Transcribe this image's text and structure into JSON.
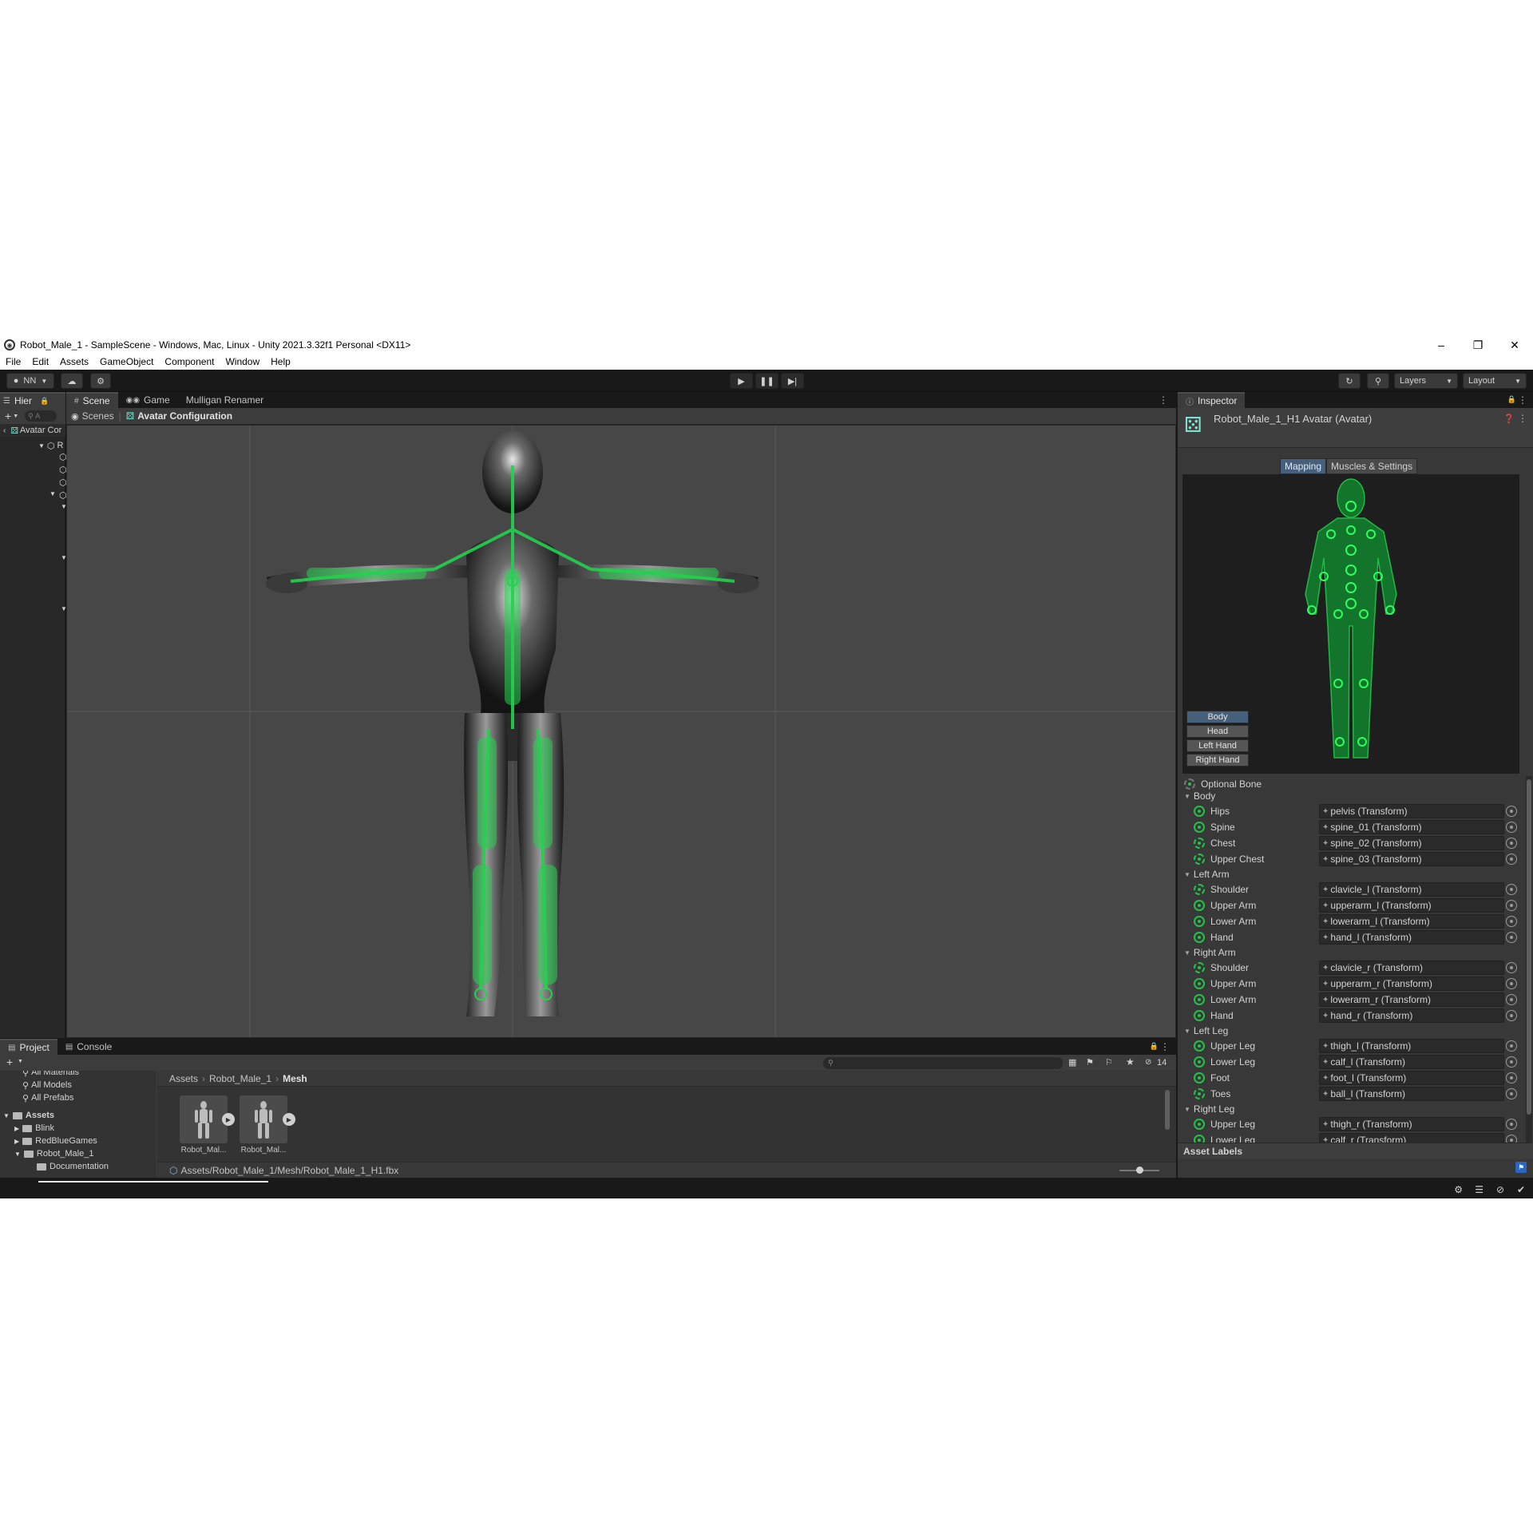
{
  "window": {
    "title": "Robot_Male_1 - SampleScene - Windows, Mac, Linux - Unity 2021.3.32f1 Personal <DX11>",
    "min": "–",
    "max": "❐",
    "close": "✕"
  },
  "menu": [
    "File",
    "Edit",
    "Assets",
    "GameObject",
    "Component",
    "Window",
    "Help"
  ],
  "toolbar": {
    "account": "NN",
    "layers": "Layers",
    "layout": "Layout"
  },
  "hierarchy": {
    "tab": "Hier",
    "search_placeholder": "A",
    "root": "Avatar Cor",
    "item": "R"
  },
  "scene": {
    "tabs": [
      "Scene",
      "Game",
      "Mulligan Renamer"
    ],
    "breadcrumb_scenes": "Scenes",
    "breadcrumb_current": "Avatar Configuration"
  },
  "inspector": {
    "tab": "Inspector",
    "object_name": "Robot_Male_1_H1 Avatar (Avatar)",
    "mode_tabs": [
      "Mapping",
      "Muscles & Settings"
    ],
    "parts": [
      "Body",
      "Head",
      "Left Hand",
      "Right Hand"
    ],
    "optional_bone": "Optional Bone",
    "groups": [
      {
        "name": "Body",
        "bones": [
          {
            "name": "Hips",
            "value": "pelvis (Transform)"
          },
          {
            "name": "Spine",
            "value": "spine_01 (Transform)"
          },
          {
            "name": "Chest",
            "value": "spine_02 (Transform)"
          },
          {
            "name": "Upper Chest",
            "value": "spine_03 (Transform)"
          }
        ]
      },
      {
        "name": "Left Arm",
        "bones": [
          {
            "name": "Shoulder",
            "value": "clavicle_l (Transform)"
          },
          {
            "name": "Upper Arm",
            "value": "upperarm_l (Transform)"
          },
          {
            "name": "Lower Arm",
            "value": "lowerarm_l (Transform)"
          },
          {
            "name": "Hand",
            "value": "hand_l (Transform)"
          }
        ]
      },
      {
        "name": "Right Arm",
        "bones": [
          {
            "name": "Shoulder",
            "value": "clavicle_r (Transform)"
          },
          {
            "name": "Upper Arm",
            "value": "upperarm_r (Transform)"
          },
          {
            "name": "Lower Arm",
            "value": "lowerarm_r (Transform)"
          },
          {
            "name": "Hand",
            "value": "hand_r (Transform)"
          }
        ]
      },
      {
        "name": "Left Leg",
        "bones": [
          {
            "name": "Upper Leg",
            "value": "thigh_l (Transform)"
          },
          {
            "name": "Lower Leg",
            "value": "calf_l (Transform)"
          },
          {
            "name": "Foot",
            "value": "foot_l (Transform)"
          },
          {
            "name": "Toes",
            "value": "ball_l (Transform)"
          }
        ]
      },
      {
        "name": "Right Leg",
        "bones": [
          {
            "name": "Upper Leg",
            "value": "thigh_r (Transform)"
          },
          {
            "name": "Lower Leg",
            "value": "calf_r (Transform)"
          }
        ]
      }
    ],
    "asset_labels": "Asset Labels"
  },
  "project": {
    "tabs": [
      "Project",
      "Console"
    ],
    "tree": [
      "All Materials",
      "All Models",
      "All Prefabs",
      "Assets",
      "Blink",
      "RedBlueGames",
      "Robot_Male_1",
      "Documentation"
    ],
    "breadcrumb": [
      "Assets",
      "Robot_Male_1",
      "Mesh"
    ],
    "items": [
      "Robot_Mal...",
      "Robot_Mal..."
    ],
    "hidden_count": "14",
    "path": "Assets/Robot_Male_1/Mesh/Robot_Male_1_H1.fbx"
  },
  "colors": {
    "bone_green": "#23c04a",
    "selected_blue": "#46607c"
  }
}
